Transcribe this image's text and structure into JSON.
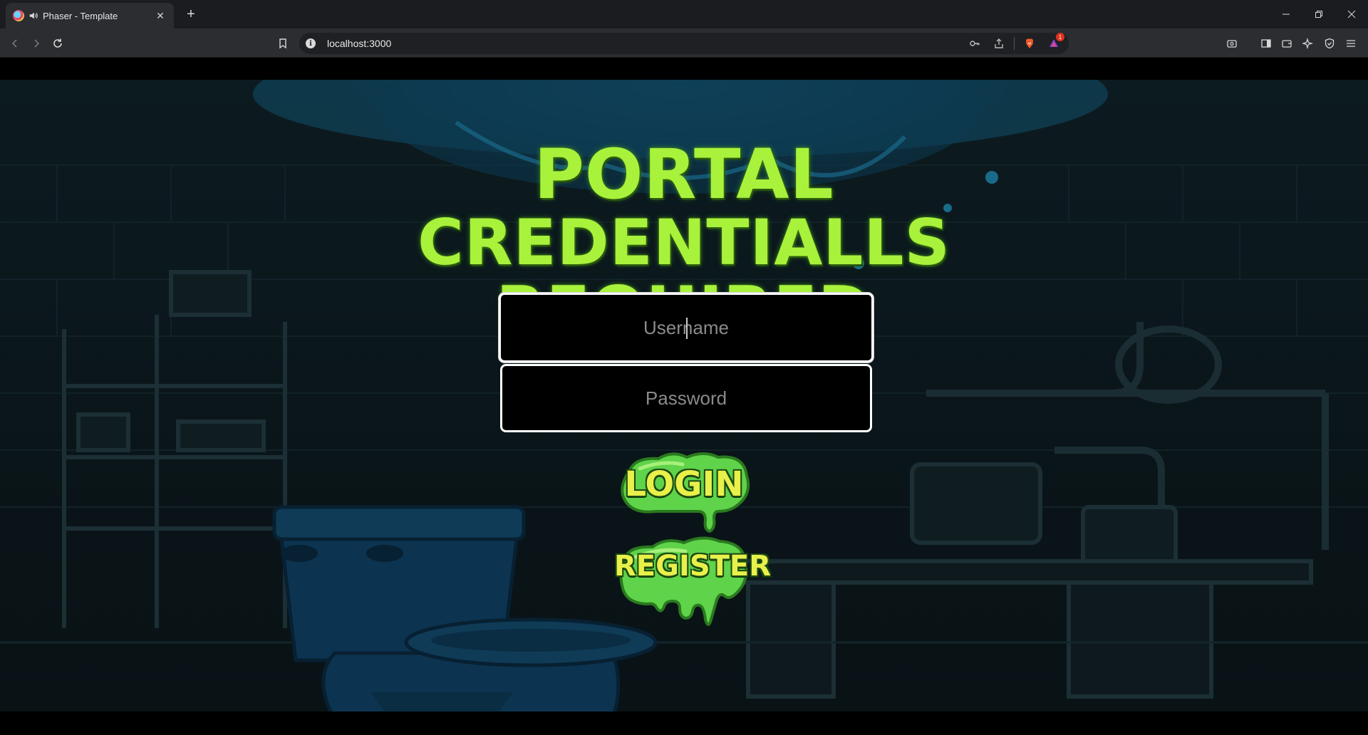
{
  "browser": {
    "tab_title": "Phaser - Template",
    "url": "localhost:3000",
    "shields_badge": "1"
  },
  "page": {
    "heading_line1": "PORTAL",
    "heading_line2": "CREDENTIALLS",
    "heading_line3": "REQUIRED",
    "username_placeholder": "Username",
    "password_placeholder": "Password",
    "login_label": "LOGIN",
    "register_label": "REGISTER"
  },
  "colors": {
    "heading": "#a8f23c",
    "slime": "#5fd34a",
    "slime_label": "#e8f04a"
  }
}
